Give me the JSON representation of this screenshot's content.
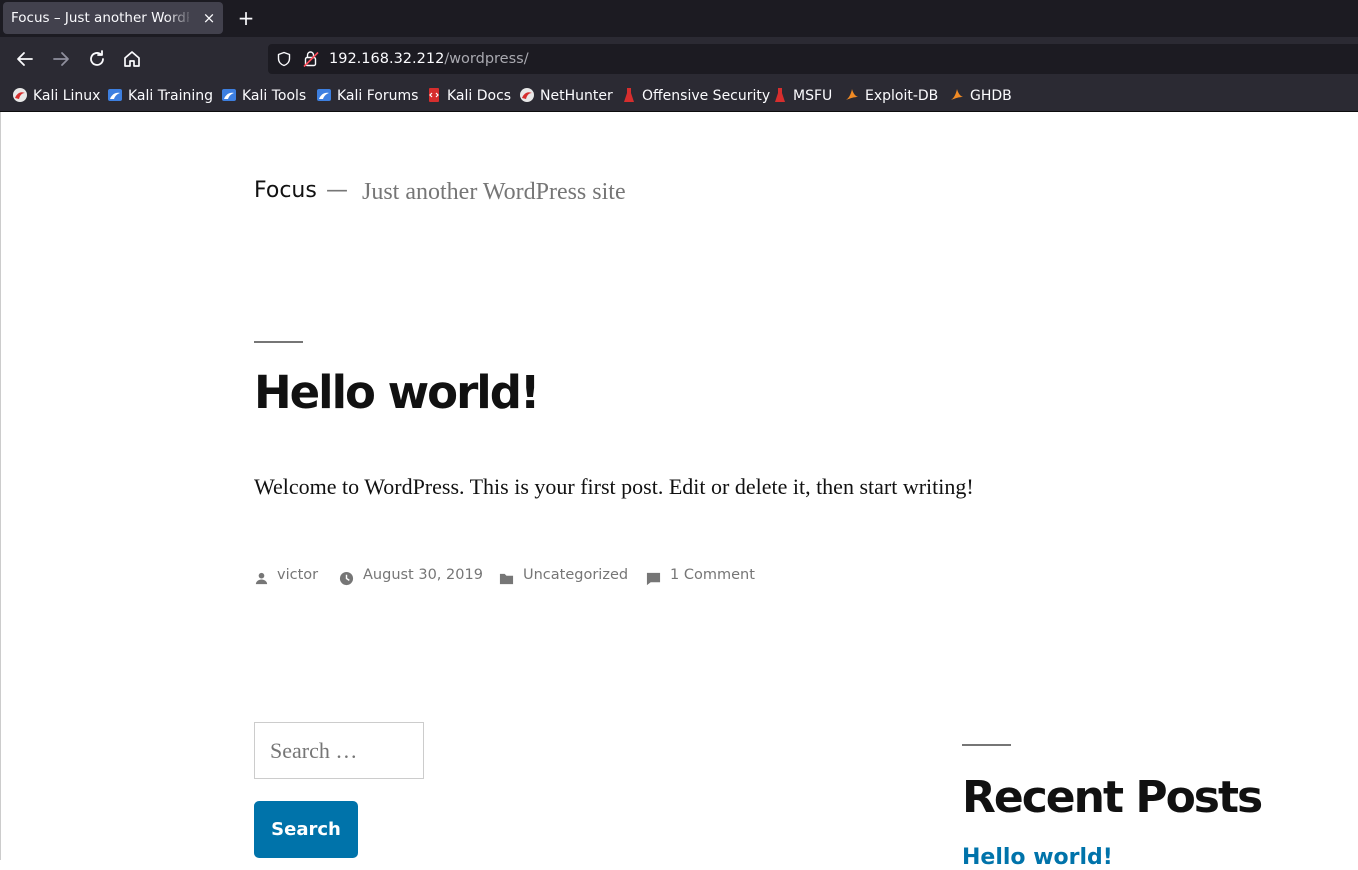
{
  "browser": {
    "tab_title": "Focus – Just another WordPress site",
    "tab_close": "×",
    "new_tab": "+",
    "url_host": "192.168.32.212",
    "url_path": "/wordpress/",
    "bookmarks": [
      {
        "label": "Kali Linux",
        "icon": "kali-dragon-icon"
      },
      {
        "label": "Kali Training",
        "icon": "kali-training-icon"
      },
      {
        "label": "Kali Tools",
        "icon": "kali-tools-icon"
      },
      {
        "label": "Kali Forums",
        "icon": "kali-forums-icon"
      },
      {
        "label": "Kali Docs",
        "icon": "kali-docs-icon"
      },
      {
        "label": "NetHunter",
        "icon": "nethunter-icon"
      },
      {
        "label": "Offensive Security",
        "icon": "offsec-icon"
      },
      {
        "label": "MSFU",
        "icon": "msfu-icon"
      },
      {
        "label": "Exploit-DB",
        "icon": "exploit-db-icon"
      },
      {
        "label": "GHDB",
        "icon": "ghdb-icon"
      }
    ]
  },
  "site": {
    "title": "Focus",
    "separator": "—",
    "description": "Just another WordPress site"
  },
  "post": {
    "title": "Hello world!",
    "body": "Welcome to WordPress. This is your first post. Edit or delete it, then start writing!",
    "author": "victor",
    "date": "August 30, 2019",
    "category": "Uncategorized",
    "comments": "1 Comment"
  },
  "search": {
    "placeholder": "Search …",
    "button": "Search"
  },
  "sidebar": {
    "widget_title": "Recent Posts",
    "recent_post": "Hello world!"
  },
  "colors": {
    "accent": "#0073aa",
    "text": "#111111",
    "muted": "#767676"
  }
}
